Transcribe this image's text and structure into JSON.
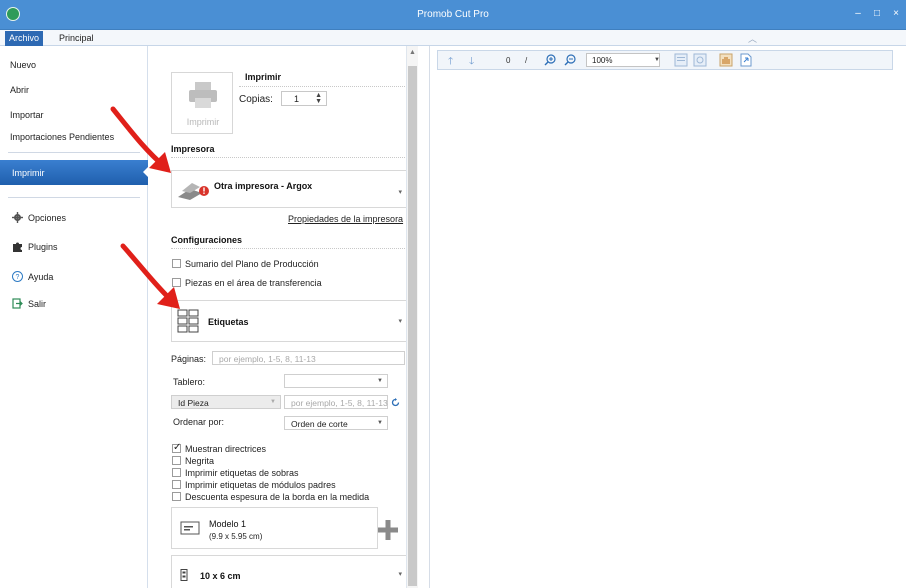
{
  "window": {
    "title": "Promob Cut Pro",
    "controls": [
      "–",
      "□",
      "×"
    ]
  },
  "menubar": {
    "tabs": [
      "Archivo",
      "Principal"
    ]
  },
  "left_nav": {
    "top_items": [
      "Nuevo",
      "Abrir",
      "Importar",
      "Importaciones Pendientes"
    ],
    "active_item": "Imprimir",
    "bottom_items": [
      {
        "label": "Opciones",
        "icon": "gear-icon"
      },
      {
        "label": "Plugins",
        "icon": "puzzle-icon"
      },
      {
        "label": "Ayuda",
        "icon": "help-icon"
      },
      {
        "label": "Salir",
        "icon": "exit-icon"
      }
    ]
  },
  "print_section": {
    "title": "Imprimir",
    "button_label": "Imprimir",
    "copies_label": "Copias:",
    "copies_value": "1"
  },
  "printer_section": {
    "title": "Impresora",
    "selected_printer": "Otra impresora - Argox",
    "properties_link": "Propiedades de la impresora"
  },
  "config_section": {
    "title": "Configuraciones",
    "checkboxes_top": [
      {
        "label": "Sumario del Plano de Producción",
        "checked": false
      },
      {
        "label": "Piezas en el área de transferencia",
        "checked": false
      }
    ],
    "print_type": "Etiquetas",
    "pages_label": "Páginas:",
    "pages_placeholder": "por ejemplo, 1-5, 8, 11-13",
    "board_label": "Tablero:",
    "board_value": "",
    "piece_select": "Id Pieza",
    "piece_placeholder": "por ejemplo, 1-5, 8, 11-13",
    "order_label": "Ordenar por:",
    "order_value": "Orden de corte",
    "checkboxes_bottom": [
      {
        "label": "Muestran directrices",
        "checked": true
      },
      {
        "label": "Negrita",
        "checked": false
      },
      {
        "label": "Imprimir etiquetas de sobras",
        "checked": false
      },
      {
        "label": "Imprimir etiquetas de módulos padres",
        "checked": false
      },
      {
        "label": "Descuenta espesura de la borda en la medida",
        "checked": false
      }
    ],
    "model_name": "Modelo 1",
    "model_size": "(9.9 x 5.95 cm)",
    "label_size": "10 x 6 cm"
  },
  "preview_toolbar": {
    "page_value": "0",
    "page_separator": "/",
    "zoom_value": "100%"
  },
  "colors": {
    "titlebar": "#4a8fd4",
    "active_nav": "#2d69b3",
    "annotation_arrow": "#e0201a"
  }
}
